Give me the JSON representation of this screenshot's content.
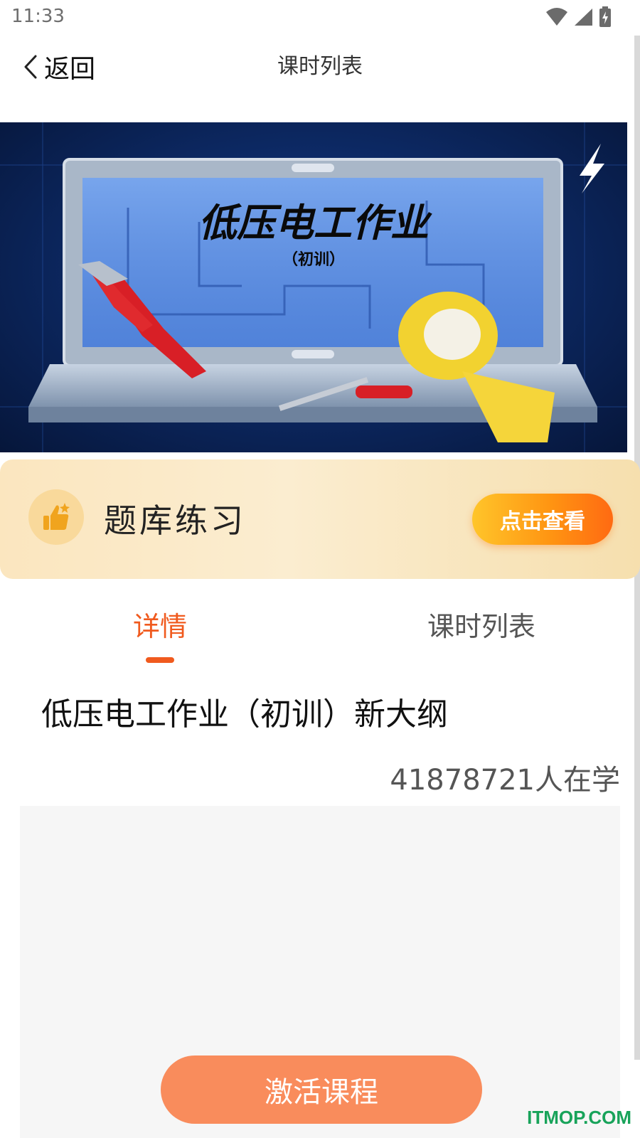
{
  "status_bar": {
    "time": "11:33",
    "icons": [
      "wifi-icon",
      "cellular-signal-icon",
      "battery-charging-icon"
    ]
  },
  "nav": {
    "back_label": "返回",
    "title": "课时列表"
  },
  "banner": {
    "title": "低压电工作业",
    "subtitle": "（初训）"
  },
  "quiz_card": {
    "title": "题库练习",
    "button_label": "点击查看",
    "icon": "thumbs-up-icon"
  },
  "tabs": [
    {
      "label": "详情",
      "active": true
    },
    {
      "label": "课时列表",
      "active": false
    }
  ],
  "course": {
    "title": "低压电工作业（初训）新大纲",
    "learner_count": "41878721人在学"
  },
  "activate_button": {
    "label": "激活课程"
  },
  "watermark": "ITMOP.COM",
  "colors": {
    "accent": "#f05a1e",
    "activate_button": "#f98c5c",
    "quiz_button": "#ff9512",
    "quiz_card_bg": "#fbe6bf",
    "banner_bg": "#0d2a66"
  }
}
